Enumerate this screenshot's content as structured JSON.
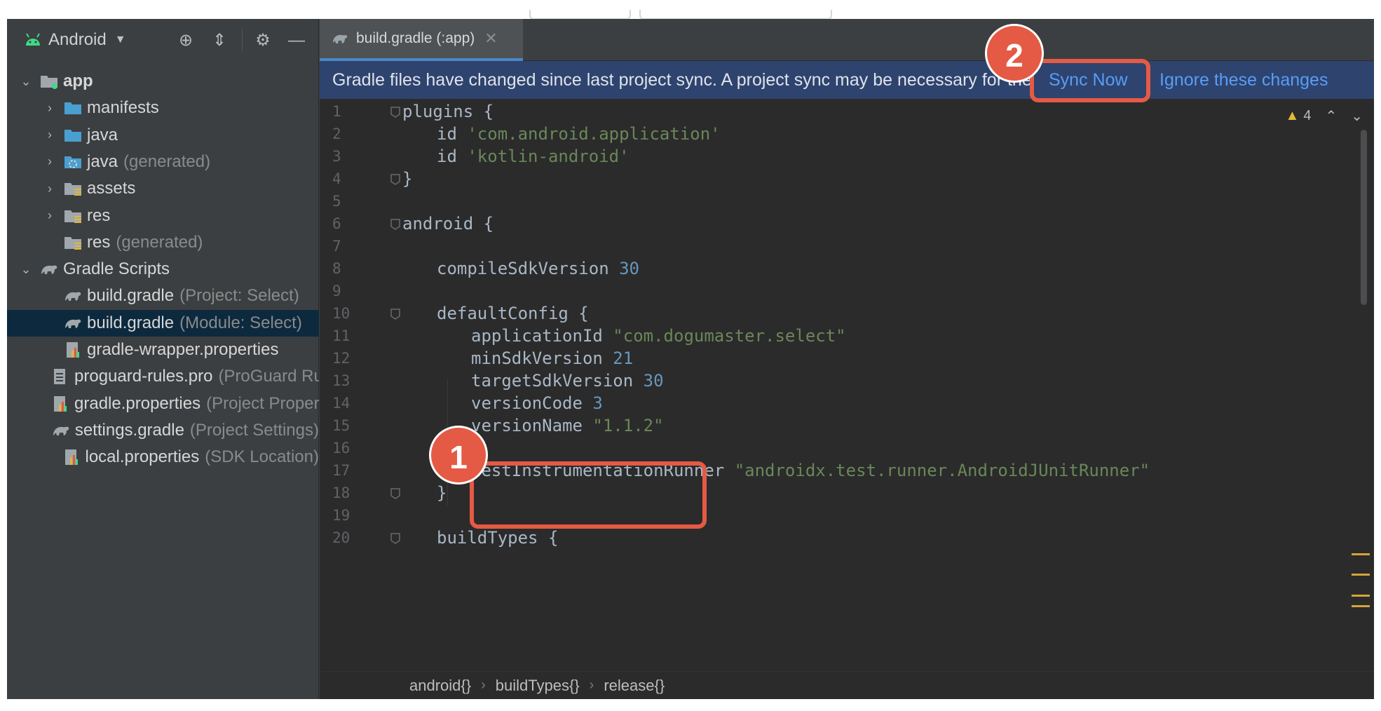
{
  "project_panel": {
    "view_title": "Android",
    "tree": [
      {
        "name": "app",
        "hint": "",
        "bold": true,
        "arrow": "down",
        "icon": "module-folder-icon",
        "indent": 1
      },
      {
        "name": "manifests",
        "hint": "",
        "arrow": "right",
        "icon": "folder-icon",
        "indent": 2
      },
      {
        "name": "java",
        "hint": "",
        "arrow": "right",
        "icon": "folder-icon",
        "indent": 2
      },
      {
        "name": "java",
        "hint": "(generated)",
        "arrow": "right",
        "icon": "generated-folder-icon",
        "indent": 2
      },
      {
        "name": "assets",
        "hint": "",
        "arrow": "right",
        "icon": "resource-folder-icon",
        "indent": 2
      },
      {
        "name": "res",
        "hint": "",
        "arrow": "right",
        "icon": "resource-folder-icon",
        "indent": 2
      },
      {
        "name": "res",
        "hint": "(generated)",
        "arrow": "none",
        "icon": "resource-folder-icon",
        "indent": 2
      },
      {
        "name": "Gradle Scripts",
        "hint": "",
        "arrow": "down",
        "icon": "gradle-icon",
        "indent": 1
      },
      {
        "name": "build.gradle",
        "hint": "(Project: Select)",
        "arrow": "none",
        "icon": "gradle-icon",
        "indent": 2
      },
      {
        "name": "build.gradle",
        "hint": "(Module: Select)",
        "arrow": "none",
        "icon": "gradle-icon",
        "indent": 2,
        "selected": true
      },
      {
        "name": "gradle-wrapper.properties",
        "hint": "",
        "arrow": "none",
        "icon": "properties-file-icon",
        "indent": 2
      },
      {
        "name": "proguard-rules.pro",
        "hint": "(ProGuard Rules)",
        "arrow": "none",
        "icon": "text-file-icon",
        "indent": 2
      },
      {
        "name": "gradle.properties",
        "hint": "(Project Properties)",
        "arrow": "none",
        "icon": "properties-file-icon",
        "indent": 2
      },
      {
        "name": "settings.gradle",
        "hint": "(Project Settings)",
        "arrow": "none",
        "icon": "gradle-icon",
        "indent": 2
      },
      {
        "name": "local.properties",
        "hint": "(SDK Location)",
        "arrow": "none",
        "icon": "properties-file-icon",
        "indent": 2
      }
    ]
  },
  "editor": {
    "tab_label": "build.gradle (:app)",
    "banner_text": "Gradle files have changed since last project sync. A project sync may be necessary for the IDE to work properly.",
    "sync_now": "Sync Now",
    "ignore_changes": "Ignore these changes",
    "warning_count": "4",
    "lines": [
      {
        "n": "1",
        "indent": 0,
        "parts": [
          [
            "kw",
            "plugins {"
          ]
        ],
        "fold": true
      },
      {
        "n": "2",
        "indent": 1,
        "parts": [
          [
            "kw",
            "id "
          ],
          [
            "str",
            "'com.android.application'"
          ]
        ]
      },
      {
        "n": "3",
        "indent": 1,
        "parts": [
          [
            "kw",
            "id "
          ],
          [
            "str",
            "'kotlin-android'"
          ]
        ]
      },
      {
        "n": "4",
        "indent": 0,
        "parts": [
          [
            "kw",
            "}"
          ]
        ],
        "fold": true
      },
      {
        "n": "5",
        "indent": 0,
        "parts": []
      },
      {
        "n": "6",
        "indent": 0,
        "parts": [
          [
            "kw",
            "android {"
          ]
        ],
        "fold": true
      },
      {
        "n": "7",
        "indent": 0,
        "parts": []
      },
      {
        "n": "8",
        "indent": 1,
        "parts": [
          [
            "kw",
            "compileSdkVersion "
          ],
          [
            "num",
            "30"
          ]
        ]
      },
      {
        "n": "9",
        "indent": 0,
        "parts": []
      },
      {
        "n": "10",
        "indent": 1,
        "parts": [
          [
            "kw",
            "defaultConfig {"
          ]
        ],
        "fold": true
      },
      {
        "n": "11",
        "indent": 2,
        "parts": [
          [
            "kw",
            "applicationId "
          ],
          [
            "str",
            "\"com.dogumaster.select\""
          ]
        ]
      },
      {
        "n": "12",
        "indent": 2,
        "parts": [
          [
            "kw",
            "minSdkVersion "
          ],
          [
            "num",
            "21"
          ]
        ]
      },
      {
        "n": "13",
        "indent": 2,
        "parts": [
          [
            "kw",
            "targetSdkVersion "
          ],
          [
            "num",
            "30"
          ]
        ]
      },
      {
        "n": "14",
        "indent": 2,
        "parts": [
          [
            "kw",
            "versionCode "
          ],
          [
            "num",
            "3"
          ]
        ]
      },
      {
        "n": "15",
        "indent": 2,
        "parts": [
          [
            "kw",
            "versionName "
          ],
          [
            "str",
            "\"1.1.2\""
          ]
        ]
      },
      {
        "n": "16",
        "indent": 0,
        "parts": []
      },
      {
        "n": "17",
        "indent": 2,
        "parts": [
          [
            "kw",
            "testInstrumentationRunner "
          ],
          [
            "str",
            "\"androidx.test.runner.AndroidJUnitRunner\""
          ]
        ]
      },
      {
        "n": "18",
        "indent": 1,
        "parts": [
          [
            "kw",
            "}"
          ]
        ],
        "fold": true
      },
      {
        "n": "19",
        "indent": 0,
        "parts": []
      },
      {
        "n": "20",
        "indent": 1,
        "parts": [
          [
            "kw",
            "buildTypes {"
          ]
        ],
        "fold": true
      }
    ],
    "breadcrumbs": [
      "android{}",
      "buildTypes{}",
      "release{}"
    ]
  },
  "annotations": {
    "badge_1": "1",
    "badge_2": "2"
  },
  "colors": {
    "accent": "#e55a44",
    "link": "#589df6",
    "banner": "#2e436e",
    "string": "#6a8759",
    "number": "#6897bb"
  }
}
